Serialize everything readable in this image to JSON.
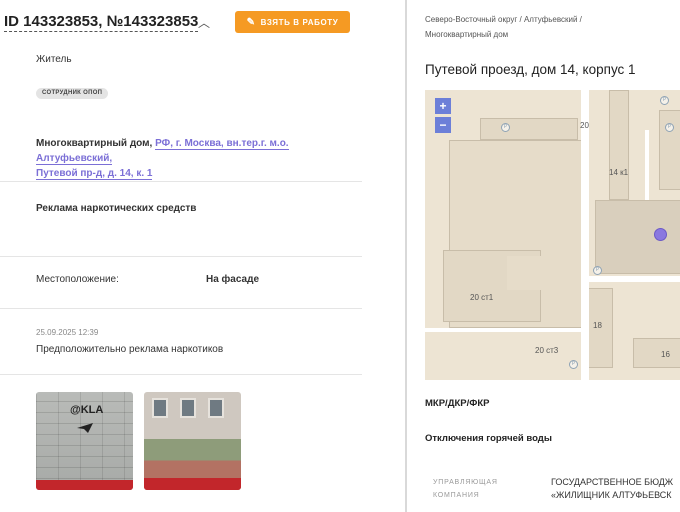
{
  "header": {
    "title": "ID 143323853, №143323853",
    "take_button_label": "ВЗЯТЬ В РАБОТУ"
  },
  "applicant": {
    "role": "Житель",
    "badge": "СОТРУДНИК ОПОП"
  },
  "address": {
    "object_type": "Многоквартирный дом,",
    "link_line1": "РФ, г. Москва, вн.тер.г. м.о. Алтуфьевский,",
    "link_line2": "Путевой пр-д, д. 14, к. 1"
  },
  "category": "Реклама наркотических средств",
  "location": {
    "label": "Местоположение:",
    "value": "На фасаде"
  },
  "comment": {
    "date": "25.09.2025 12:39",
    "text": "Предположительно реклама наркотиков"
  },
  "photos": {
    "graffiti_text": "@KLA"
  },
  "right": {
    "breadcrumb_line1": "Северо-Восточный округ / Алтуфьевский /",
    "breadcrumb_line2": "Многоквартирный дом",
    "title": "Путевой проезд, дом 14, корпус 1",
    "section1": "МКР/ДКР/ФКР",
    "section2": "Отключения горячей воды",
    "mc_label_line1": "УПРАВЛЯЮЩАЯ",
    "mc_label_line2": "КОМПАНИЯ",
    "mc_value_line1": "ГОСУДАРСТВЕННОЕ БЮДЖ",
    "mc_value_line2": "«ЖИЛИЩНИК АЛТУФЬЕВСК"
  },
  "map": {
    "zoom_in": "+",
    "zoom_out": "−",
    "parking": "P",
    "labels": {
      "b20": "20",
      "b14k1": "14 к1",
      "b20st1": "20 ст1",
      "b20st3": "20 ст3",
      "b18": "18",
      "b16": "16"
    },
    "marker_color": "#8a78e0"
  },
  "colors": {
    "accent_orange": "#f59a23",
    "link_purple": "#7b6fd6",
    "zoom_blue": "#6c7fd8"
  }
}
